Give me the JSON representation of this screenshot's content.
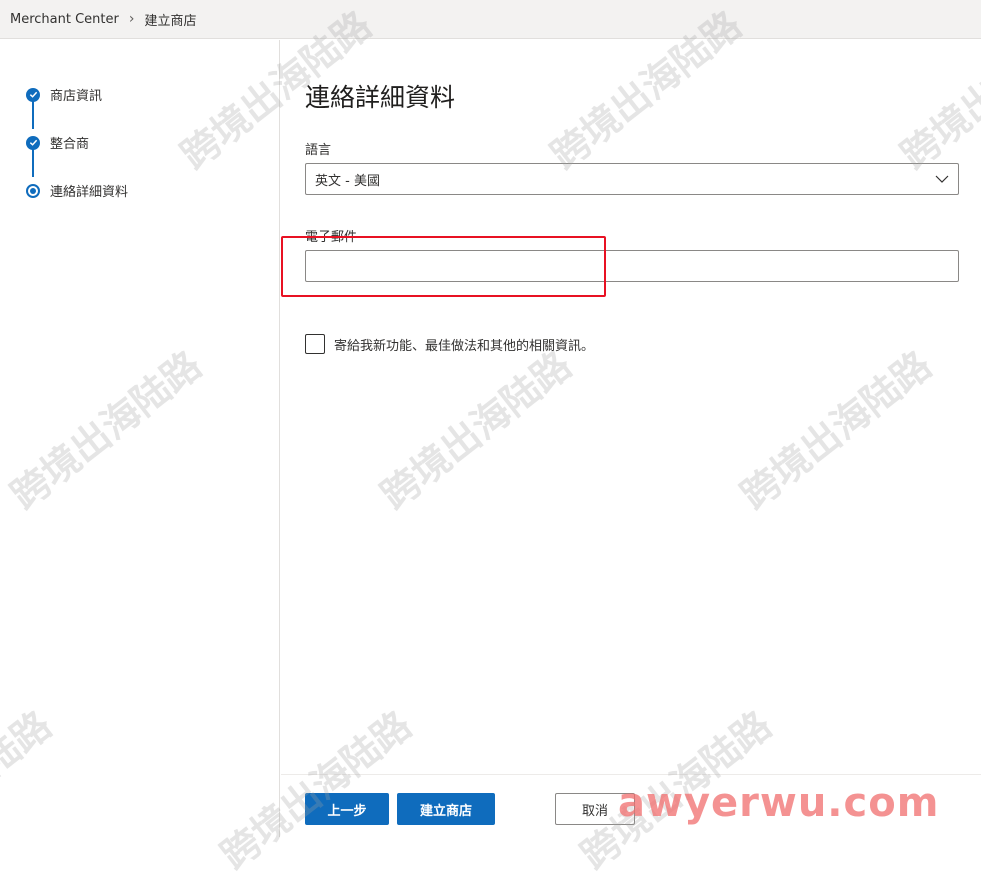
{
  "breadcrumb": {
    "root": "Merchant Center",
    "current": "建立商店"
  },
  "steps": [
    {
      "label": "商店資訊",
      "state": "done"
    },
    {
      "label": "整合商",
      "state": "done"
    },
    {
      "label": "連絡詳細資料",
      "state": "current"
    }
  ],
  "main": {
    "title": "連絡詳細資料",
    "language_label": "語言",
    "language_value": "英文 - 美國",
    "email_label": "電子郵件",
    "email_value": "",
    "newsletter_label": "寄給我新功能、最佳做法和其他的相關資訊。"
  },
  "buttons": {
    "back": "上一步",
    "create": "建立商店",
    "cancel": "取消"
  },
  "watermarks": {
    "text": "跨境出海陆路",
    "site": "awyerwu.com"
  },
  "colors": {
    "accent": "#0f6cbd",
    "highlight": "#e81123"
  }
}
